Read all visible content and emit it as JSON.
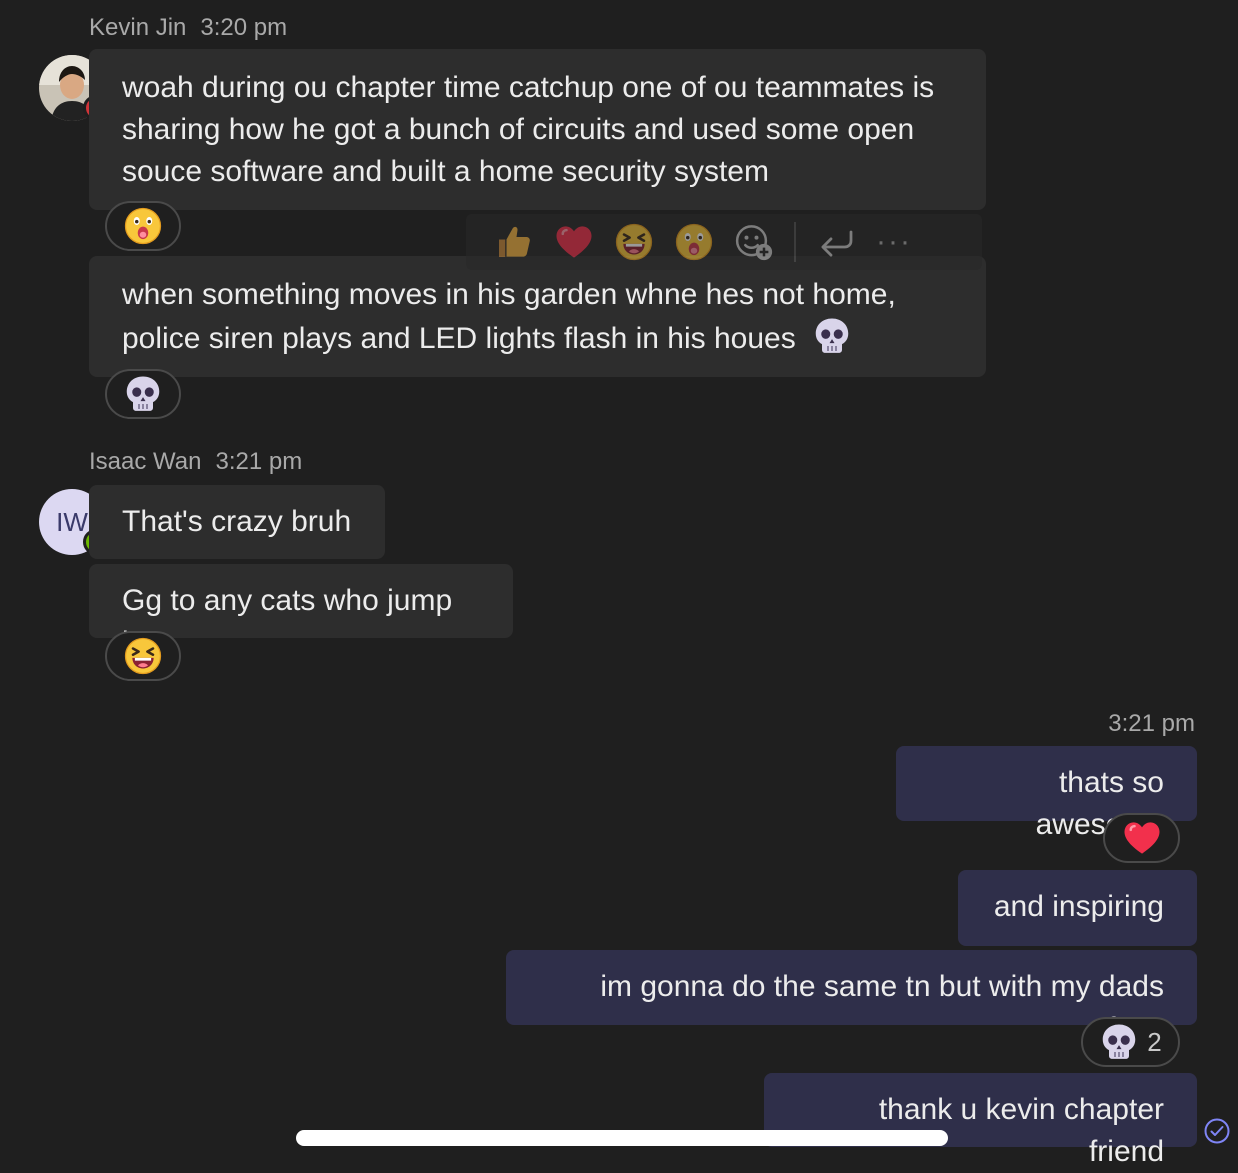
{
  "messages": {
    "kevin": {
      "name": "Kevin Jin",
      "time": "3:20 pm",
      "text1": "woah during ou chapter time catchup one of ou teammates is sharing how he got a bunch of circuits and used some open souce software and built a home security system",
      "text2": "when something moves in his garden whne hes not home, police siren plays and LED lights flash in his houes"
    },
    "isaac": {
      "name": "Isaac Wan",
      "initials": "IW",
      "time": "3:21 pm",
      "text1": "That's crazy bruh",
      "text2": "Gg to any cats who jump in"
    },
    "me": {
      "time": "3:21 pm",
      "text1": "thats so awesome",
      "text2": "and inspiring",
      "text3": "im gonna do the same tn but with my dads face",
      "text4": "thank u kevin chapter friend",
      "skull_count": "2"
    }
  },
  "reaction_icons": [
    "surprised-face",
    "skull",
    "laughing-face",
    "red-heart",
    "skull"
  ],
  "toolbar_icons": [
    "thumbs-up",
    "heart",
    "laugh",
    "surprised",
    "add-reaction",
    "reply",
    "more"
  ],
  "colors": {
    "background": "#1f1f1f",
    "incoming_bubble": "#2d2d2d",
    "outgoing_bubble": "#2f2f4a",
    "presence_busy": "#d13438",
    "presence_available": "#6bb700",
    "accent": "#7f85f5"
  }
}
